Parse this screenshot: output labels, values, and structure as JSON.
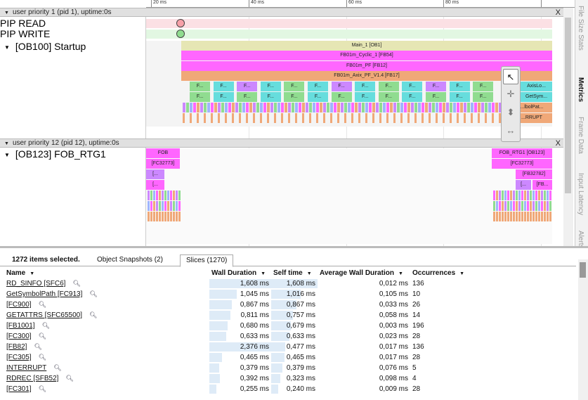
{
  "ruler": {
    "labels": [
      "20 ms",
      "40 ms",
      "60 ms",
      "80 ms"
    ]
  },
  "process1": {
    "header": "user priority 1 (pid 1), uptime:0s",
    "tracks": {
      "pip_read": "PIP READ",
      "pip_write": "PIP WRITE",
      "ob100": "[OB100] Startup"
    },
    "slices": {
      "main": "Main_1 [OB1]",
      "fb54": "FB01m_Cyclic_1 [FB54]",
      "fb12": "FB01m_PF [FB12]",
      "fb17": "FB01m_Axix_PF_V1.4 [FB17]",
      "small": "F...",
      "axislo": "AxisLo...",
      "getsym": "GetSym...",
      "symbolpat": "...lbolPat...",
      "interrupt": "...RRUPT"
    }
  },
  "process2": {
    "header": "user priority 12 (pid 12), uptime:0s",
    "track": "[OB123] FOB_RTG1",
    "slices": {
      "fob": "FOB",
      "fc32773_l": "[FC32773]",
      "dots1": "[...",
      "dots2": "[...",
      "fob_rtg1": "FOB_RTG1 [OB123]",
      "fc32773_r": "[FC32773]",
      "fb32782": "[FB32782]",
      "dots3": "[...",
      "fbdots": "[FB..."
    }
  },
  "close_glyph": "X",
  "side_tabs": [
    "File Size Stats",
    "Metrics",
    "Frame Data",
    "Input Latency",
    "Alerts"
  ],
  "bottom": {
    "selected": "1272 items selected.",
    "tabs": [
      "Object Snapshots (2)",
      "Slices (1270)"
    ],
    "columns": [
      "Name",
      "Wall Duration",
      "Self time",
      "Average Wall Duration",
      "Occurrences"
    ],
    "rows": [
      {
        "name": "RD_SINFO [SFC6]",
        "wall": "1,608 ms",
        "self": "1,608 ms",
        "avg": "0,012 ms",
        "occ": "136",
        "wall_frac": 1.0,
        "self_frac": 1.0
      },
      {
        "name": "GetSymbolPath [FC913]",
        "wall": "1,045 ms",
        "self": "1,016 ms",
        "avg": "0,105 ms",
        "occ": "10",
        "wall_frac": 0.44,
        "self_frac": 0.63
      },
      {
        "name": "[FC900]",
        "wall": "0,867 ms",
        "self": "0,867 ms",
        "avg": "0,033 ms",
        "occ": "26",
        "wall_frac": 0.36,
        "self_frac": 0.54
      },
      {
        "name": "GETATTRS [SFC65500]",
        "wall": "0,811 ms",
        "self": "0,757 ms",
        "avg": "0,058 ms",
        "occ": "14",
        "wall_frac": 0.34,
        "self_frac": 0.47
      },
      {
        "name": "[FB1001]",
        "wall": "0,680 ms",
        "self": "0,679 ms",
        "avg": "0,003 ms",
        "occ": "196",
        "wall_frac": 0.29,
        "self_frac": 0.42
      },
      {
        "name": "[FC300]",
        "wall": "0,633 ms",
        "self": "0,633 ms",
        "avg": "0,023 ms",
        "occ": "28",
        "wall_frac": 0.27,
        "self_frac": 0.39
      },
      {
        "name": "[FB82]",
        "wall": "2,376 ms",
        "self": "0,477 ms",
        "avg": "0,017 ms",
        "occ": "136",
        "wall_frac": 1.0,
        "self_frac": 0.3
      },
      {
        "name": "[FC305]",
        "wall": "0,465 ms",
        "self": "0,465 ms",
        "avg": "0,017 ms",
        "occ": "28",
        "wall_frac": 0.2,
        "self_frac": 0.29
      },
      {
        "name": "INTERRUPT",
        "wall": "0,379 ms",
        "self": "0,379 ms",
        "avg": "0,076 ms",
        "occ": "5",
        "wall_frac": 0.16,
        "self_frac": 0.24
      },
      {
        "name": "RDREC [SFB52]",
        "wall": "0,392 ms",
        "self": "0,323 ms",
        "avg": "0,098 ms",
        "occ": "4",
        "wall_frac": 0.17,
        "self_frac": 0.2
      },
      {
        "name": "[FC301]",
        "wall": "0,255 ms",
        "self": "0,240 ms",
        "avg": "0,009 ms",
        "occ": "28",
        "wall_frac": 0.11,
        "self_frac": 0.15
      }
    ]
  },
  "colors": {
    "pink": "#ff66ff",
    "olive": "#e6e6b4",
    "orange": "#f0a878",
    "green": "#90dc90",
    "cyan": "#66dddd",
    "violet": "#cc88ff",
    "blue": "#9fb4ff",
    "pip_read_fill": "#f7a0a8",
    "pip_write_fill": "#8fdc8f"
  }
}
